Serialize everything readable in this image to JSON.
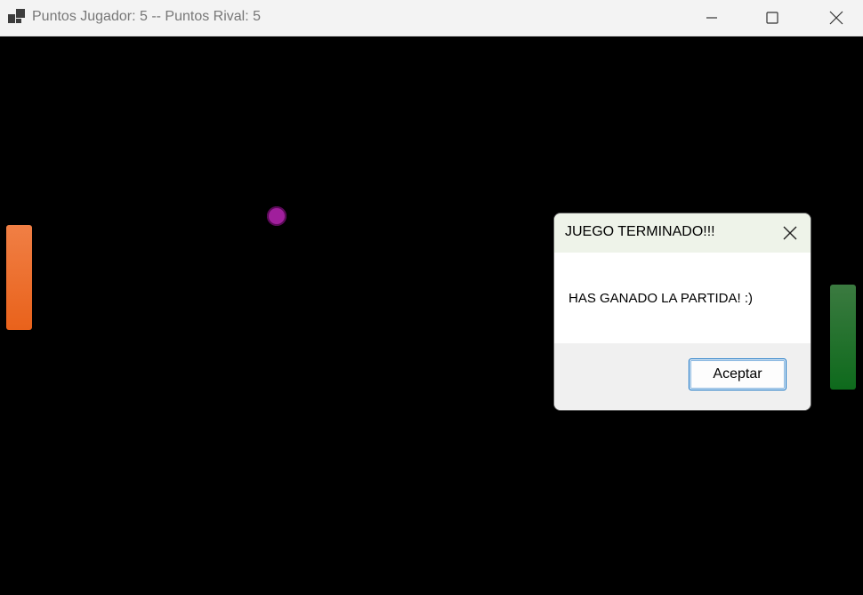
{
  "window": {
    "title": "Puntos Jugador: 5 -- Puntos Rival: 5",
    "icon": "app-window-icon",
    "controls": [
      "minimize-icon",
      "maximize-icon",
      "close-icon"
    ]
  },
  "game": {
    "background": "#000000",
    "player_paddle_color": "#ec6c2a",
    "rival_paddle_color": "#1f7030",
    "ball_color": "#a01f9c"
  },
  "dialog": {
    "title": "JUEGO TERMINADO!!!",
    "message": "HAS GANADO LA PARTIDA! :)",
    "ok_label": "Aceptar",
    "close_icon": "close-icon"
  }
}
